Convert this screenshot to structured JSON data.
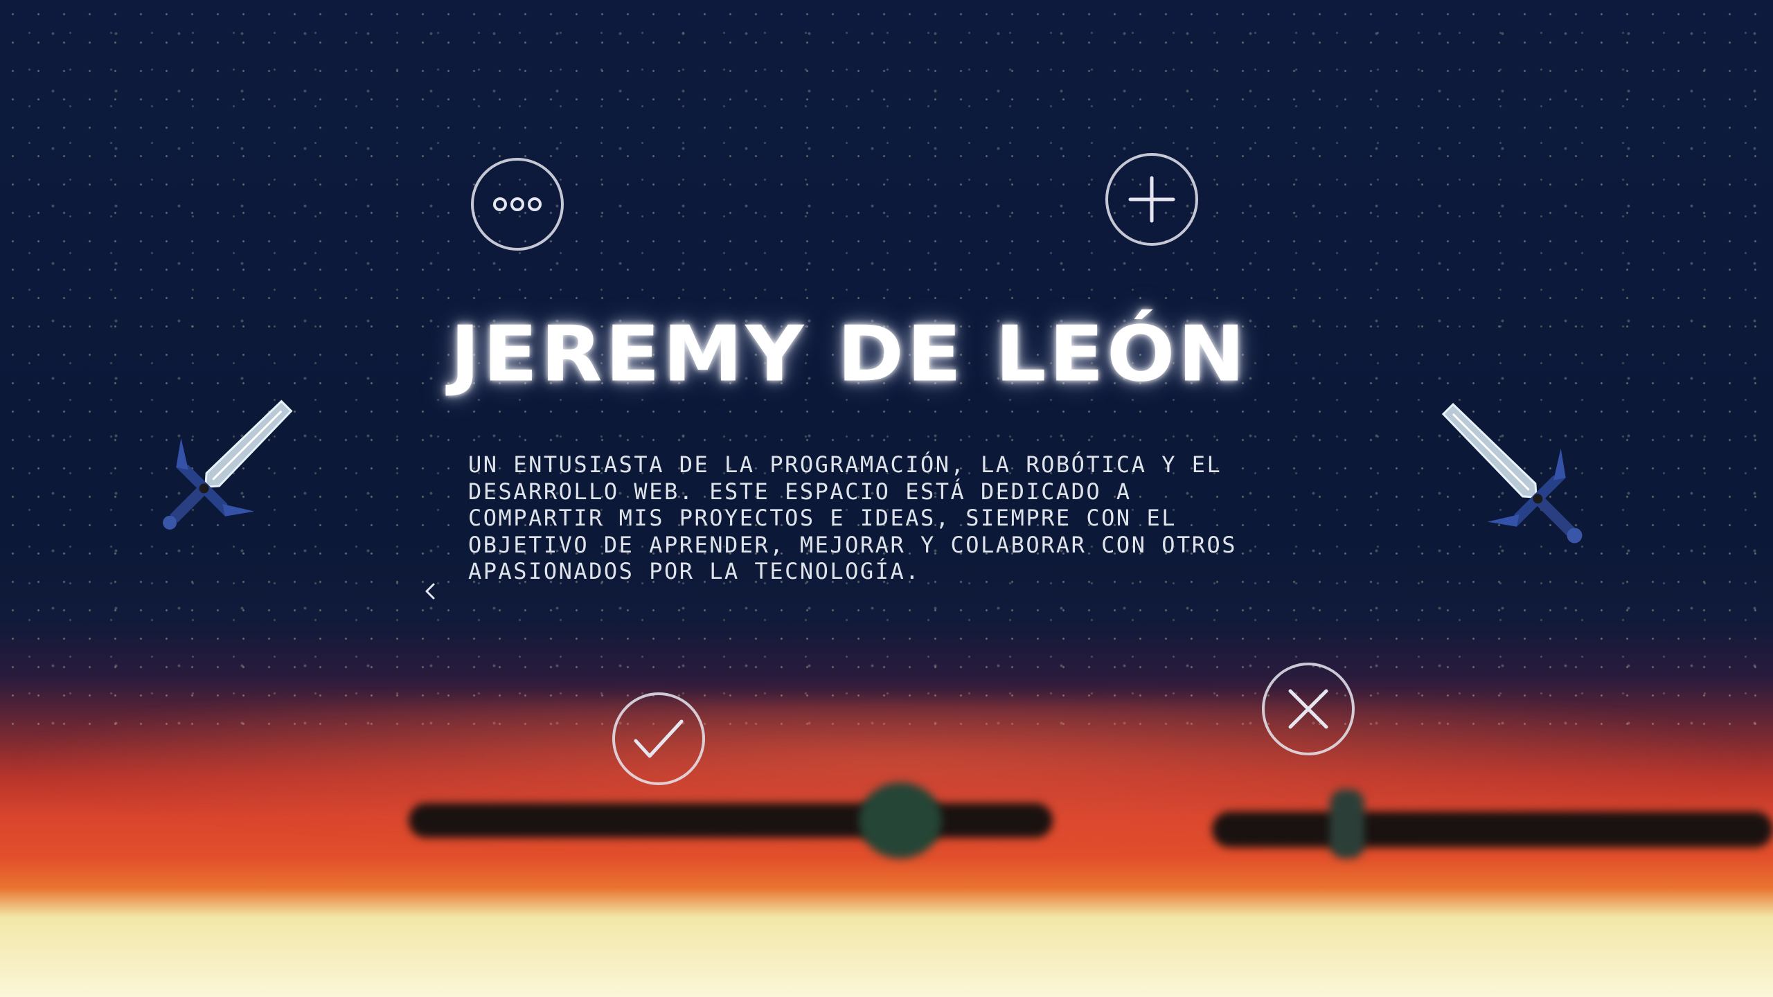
{
  "hero": {
    "title": "JEREMY DE LEÓN",
    "description": "UN ENTUSIASTA DE LA PROGRAMACIÓN, LA ROBÓTICA Y EL DESARROLLO WEB. ESTE ESPACIO ESTÁ DEDICADO A COMPARTIR MIS PROYECTOS E IDEAS, SIEMPRE CON EL OBJETIVO DE APRENDER, MEJORAR Y COLABORAR CON OTROS APASIONADOS POR LA TECNOLOGÍA."
  },
  "icons": {
    "more": "more-dots-icon",
    "add": "plus-icon",
    "check": "check-icon",
    "close": "close-icon",
    "prev": "chevron-left-icon",
    "sword": "sword-icon"
  },
  "colors": {
    "sky": "#0d1a3d",
    "horizon_red": "#d9452d",
    "sand": "#fbf6d8",
    "icon_stroke": "#e6e6f0",
    "text": "#ffffff"
  }
}
